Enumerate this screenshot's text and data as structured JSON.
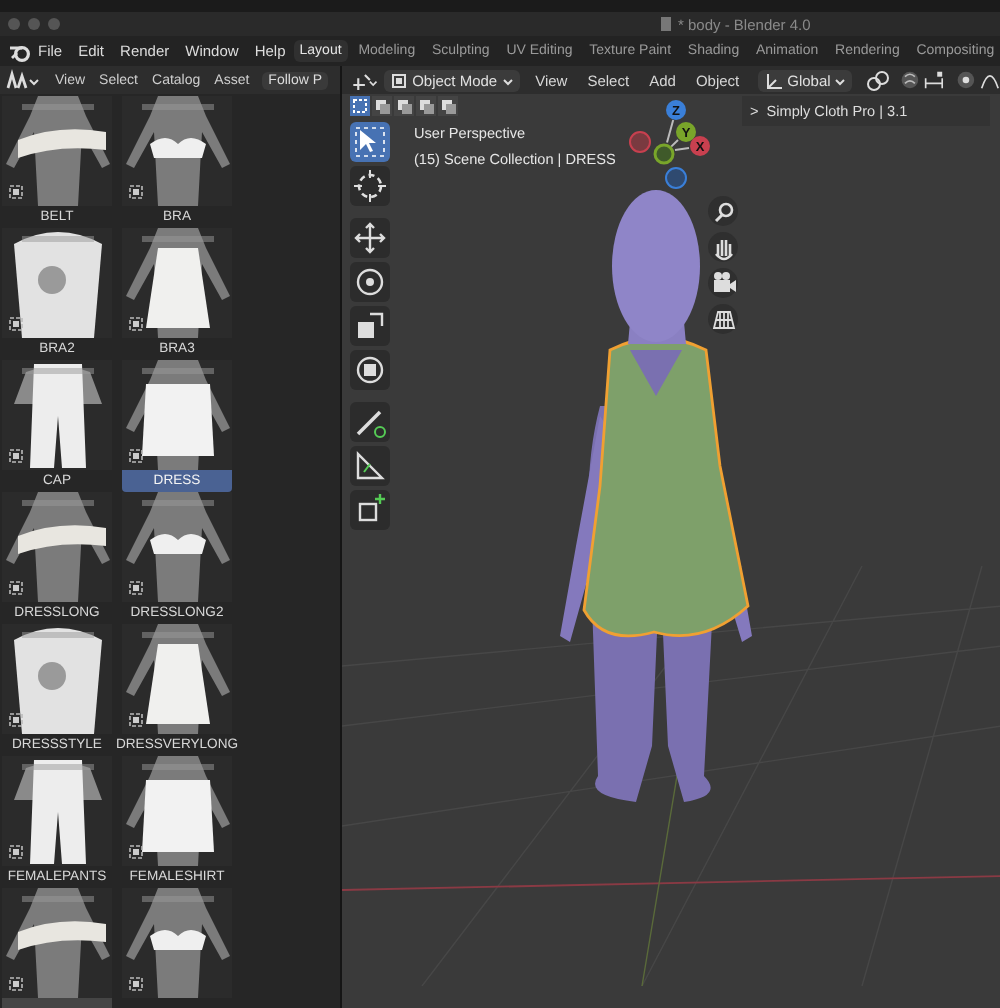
{
  "window": {
    "title": "* body - Blender 4.0"
  },
  "menu": [
    "File",
    "Edit",
    "Render",
    "Window",
    "Help"
  ],
  "workspaces": [
    {
      "label": "Layout",
      "selected": true
    },
    {
      "label": "Modeling",
      "selected": false
    },
    {
      "label": "Sculpting",
      "selected": false
    },
    {
      "label": "UV Editing",
      "selected": false
    },
    {
      "label": "Texture Paint",
      "selected": false
    },
    {
      "label": "Shading",
      "selected": false
    },
    {
      "label": "Animation",
      "selected": false
    },
    {
      "label": "Rendering",
      "selected": false
    },
    {
      "label": "Compositing",
      "selected": false
    }
  ],
  "asset_browser": {
    "menu": [
      "View",
      "Select",
      "Catalog",
      "Asset"
    ],
    "button": "Follow P",
    "assets": [
      {
        "name": "BELT",
        "selected": false,
        "hovered": false
      },
      {
        "name": "BRA",
        "selected": false,
        "hovered": false
      },
      {
        "name": "BRA2",
        "selected": false,
        "hovered": false
      },
      {
        "name": "BRA3",
        "selected": false,
        "hovered": false
      },
      {
        "name": "CAP",
        "selected": false,
        "hovered": false
      },
      {
        "name": "DRESS",
        "selected": true,
        "hovered": false
      },
      {
        "name": "DRESSLONG",
        "selected": false,
        "hovered": false
      },
      {
        "name": "DRESSLONG2",
        "selected": false,
        "hovered": false
      },
      {
        "name": "DRESSSTYLE",
        "selected": false,
        "hovered": false
      },
      {
        "name": "DRESSVERYLONG",
        "selected": false,
        "hovered": false
      },
      {
        "name": "FEMALEPANTS",
        "selected": false,
        "hovered": false
      },
      {
        "name": "FEMALESHIRT",
        "selected": false,
        "hovered": false
      },
      {
        "selected": false,
        "hovered": true
      },
      {
        "selected": false,
        "hovered": false
      }
    ]
  },
  "viewport": {
    "mode": "Object Mode",
    "menu": [
      "View",
      "Select",
      "Add",
      "Object"
    ],
    "orientation": "Global",
    "view_name": "User Perspective",
    "collection": "(15) Scene Collection | DRESS",
    "addon_arrow": ">",
    "addon": "Simply Cloth Pro | 3.1",
    "axes": [
      "Z",
      "Y",
      "X"
    ],
    "tools": [
      {
        "kind": "select",
        "selected": true
      },
      {
        "kind": "cursor",
        "selected": false
      },
      {
        "kind": "move",
        "selected": false
      },
      {
        "kind": "rotate",
        "selected": false
      },
      {
        "kind": "scale",
        "selected": false
      },
      {
        "kind": "transform",
        "selected": false
      },
      {
        "kind": "annotate",
        "selected": false
      },
      {
        "kind": "measure",
        "selected": false
      },
      {
        "kind": "add",
        "selected": false
      }
    ],
    "nav": [
      {
        "kind": "zoom"
      },
      {
        "kind": "pan"
      },
      {
        "kind": "camera"
      },
      {
        "kind": "ortho"
      }
    ]
  }
}
